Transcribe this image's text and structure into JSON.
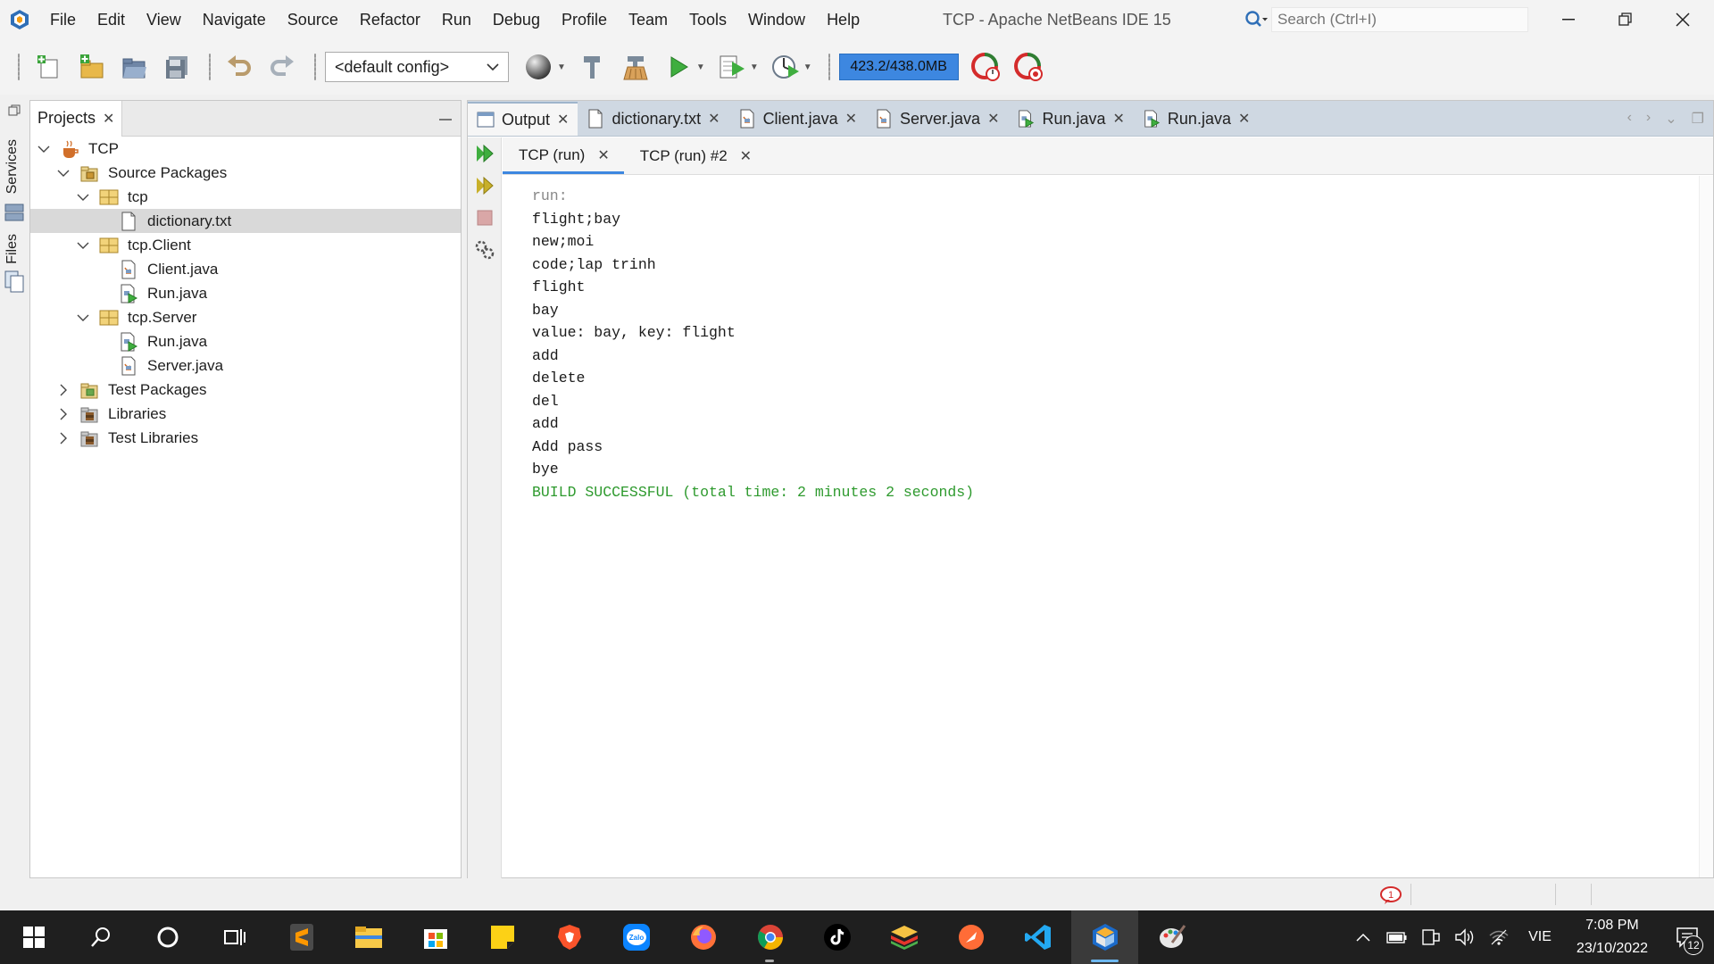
{
  "window": {
    "title": "TCP - Apache NetBeans IDE 15"
  },
  "menu": [
    "File",
    "Edit",
    "View",
    "Navigate",
    "Source",
    "Refactor",
    "Run",
    "Debug",
    "Profile",
    "Team",
    "Tools",
    "Window",
    "Help"
  ],
  "search": {
    "placeholder": "Search (Ctrl+I)"
  },
  "toolbar": {
    "config": "<default config>",
    "memory": "423.2/438.0MB"
  },
  "left_strip": {
    "services": "Services",
    "files": "Files"
  },
  "projects": {
    "tab_label": "Projects",
    "tree": [
      {
        "label": "TCP",
        "level": 0,
        "icon": "project-icon",
        "expanded": true
      },
      {
        "label": "Source Packages",
        "level": 1,
        "icon": "source-packages-icon",
        "expanded": true
      },
      {
        "label": "tcp",
        "level": 2,
        "icon": "package-icon",
        "expanded": true
      },
      {
        "label": "dictionary.txt",
        "level": 3,
        "icon": "text-file-icon",
        "selected": true
      },
      {
        "label": "tcp.Client",
        "level": 2,
        "icon": "package-icon",
        "expanded": true
      },
      {
        "label": "Client.java",
        "level": 3,
        "icon": "java-file-icon"
      },
      {
        "label": "Run.java",
        "level": 3,
        "icon": "java-main-file-icon"
      },
      {
        "label": "tcp.Server",
        "level": 2,
        "icon": "package-icon",
        "expanded": true
      },
      {
        "label": "Run.java",
        "level": 3,
        "icon": "java-main-file-icon"
      },
      {
        "label": "Server.java",
        "level": 3,
        "icon": "java-file-icon"
      },
      {
        "label": "Test Packages",
        "level": 1,
        "icon": "test-packages-icon",
        "expanded": false
      },
      {
        "label": "Libraries",
        "level": 1,
        "icon": "libraries-icon",
        "expanded": false
      },
      {
        "label": "Test Libraries",
        "level": 1,
        "icon": "libraries-icon",
        "expanded": false
      }
    ]
  },
  "editor_tabs": [
    {
      "label": "Output",
      "icon": "output-icon",
      "active": true
    },
    {
      "label": "dictionary.txt",
      "icon": "text-file-icon"
    },
    {
      "label": "Client.java",
      "icon": "java-file-icon"
    },
    {
      "label": "Server.java",
      "icon": "java-file-icon"
    },
    {
      "label": "Run.java",
      "icon": "java-main-file-icon"
    },
    {
      "label": "Run.java",
      "icon": "java-main-file-icon"
    }
  ],
  "run_tabs": [
    {
      "label": "TCP (run)",
      "active": true
    },
    {
      "label": "TCP (run) #2"
    }
  ],
  "console": {
    "lines": [
      {
        "text": "run:",
        "kind": "run"
      },
      {
        "text": "flight;bay",
        "kind": "out"
      },
      {
        "text": "new;moi",
        "kind": "out"
      },
      {
        "text": "code;lap trinh",
        "kind": "out"
      },
      {
        "text": "flight",
        "kind": "out"
      },
      {
        "text": "bay",
        "kind": "out"
      },
      {
        "text": "value: bay, key: flight",
        "kind": "out"
      },
      {
        "text": "add",
        "kind": "out"
      },
      {
        "text": "delete",
        "kind": "out"
      },
      {
        "text": "del",
        "kind": "out"
      },
      {
        "text": "add",
        "kind": "out"
      },
      {
        "text": "Add pass",
        "kind": "out"
      },
      {
        "text": "bye",
        "kind": "out"
      },
      {
        "text": "BUILD SUCCESSFUL (total time: 2 minutes 2 seconds)",
        "kind": "success"
      }
    ]
  },
  "status": {
    "notifications": "1"
  },
  "taskbar": {
    "language": "VIE",
    "time": "7:08 PM",
    "date": "23/10/2022",
    "notification_count": "12",
    "apps": [
      "windows-start-icon",
      "search-icon",
      "cortana-icon",
      "task-view-icon",
      "sublime-text-icon",
      "file-explorer-icon",
      "microsoft-store-icon",
      "sticky-notes-icon",
      "brave-icon",
      "zalo-icon",
      "firefox-icon",
      "chrome-icon",
      "tiktok-icon",
      "bluestacks-icon",
      "postman-icon",
      "vscode-icon",
      "netbeans-icon",
      "paint-icon"
    ]
  },
  "colors": {
    "accent": "#3d87e0",
    "success": "#2e9a2e",
    "tab_bar": "#cfd8e2"
  }
}
